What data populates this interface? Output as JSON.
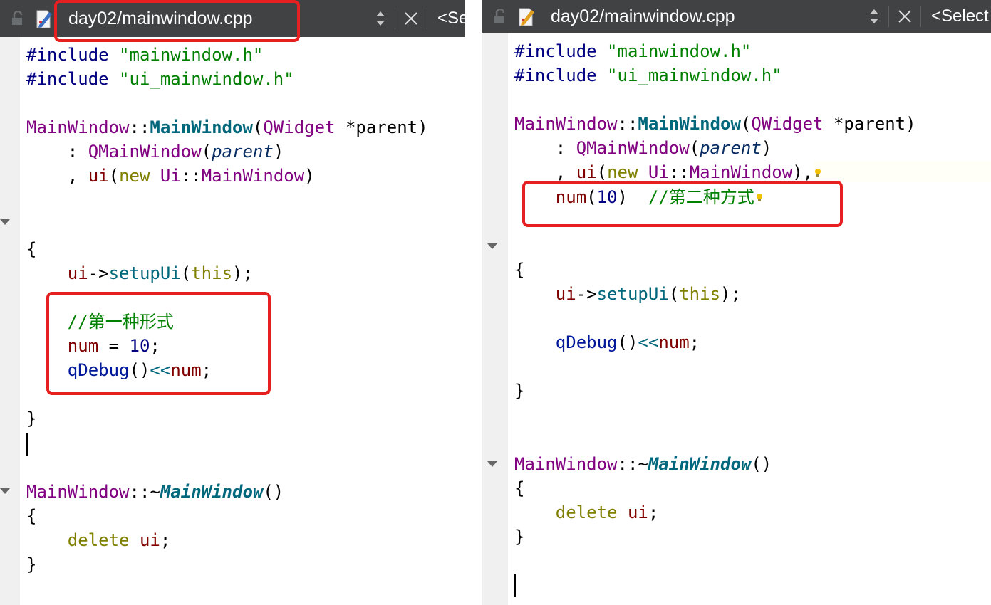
{
  "left_editor": {
    "tab": {
      "filename": "day02/mainwindow.cpp",
      "selector_label": "<Se",
      "icons": [
        "lock-icon",
        "file-edit-icon",
        "up-down-arrows-icon",
        "close-icon"
      ]
    },
    "code_lines": [
      {
        "tokens": [
          {
            "t": "#include ",
            "c": "pp"
          },
          {
            "t": "\"mainwindow.h\"",
            "c": "str"
          }
        ]
      },
      {
        "tokens": [
          {
            "t": "#include ",
            "c": "pp"
          },
          {
            "t": "\"ui_mainwindow.h\"",
            "c": "str"
          }
        ]
      },
      {
        "tokens": []
      },
      {
        "tokens": [
          {
            "t": "MainWindow",
            "c": "cls"
          },
          {
            "t": "::",
            "c": ""
          },
          {
            "t": "MainWindow",
            "c": "fnb"
          },
          {
            "t": "(",
            "c": ""
          },
          {
            "t": "QWidget",
            "c": "cls"
          },
          {
            "t": " *parent)",
            "c": ""
          }
        ]
      },
      {
        "tokens": [
          {
            "t": "    : ",
            "c": ""
          },
          {
            "t": "QMainWindow",
            "c": "cls"
          },
          {
            "t": "(",
            "c": ""
          },
          {
            "t": "parent",
            "c": "prm"
          },
          {
            "t": ")",
            "c": ""
          }
        ]
      },
      {
        "tokens": [
          {
            "t": "    , ",
            "c": ""
          },
          {
            "t": "ui",
            "c": "mem"
          },
          {
            "t": "(",
            "c": ""
          },
          {
            "t": "new",
            "c": "kw"
          },
          {
            "t": " ",
            "c": ""
          },
          {
            "t": "Ui",
            "c": "cls"
          },
          {
            "t": "::",
            "c": ""
          },
          {
            "t": "MainWindow",
            "c": "cls"
          },
          {
            "t": ")",
            "c": ""
          }
        ]
      },
      {
        "tokens": []
      },
      {
        "tokens": []
      },
      {
        "tokens": [
          {
            "t": "{",
            "c": ""
          }
        ]
      },
      {
        "tokens": [
          {
            "t": "    ",
            "c": ""
          },
          {
            "t": "ui",
            "c": "mem"
          },
          {
            "t": "->",
            "c": ""
          },
          {
            "t": "setupUi",
            "c": "fn"
          },
          {
            "t": "(",
            "c": ""
          },
          {
            "t": "this",
            "c": "kw"
          },
          {
            "t": ");",
            "c": ""
          }
        ]
      },
      {
        "tokens": []
      },
      {
        "tokens": [
          {
            "t": "    ",
            "c": ""
          },
          {
            "t": "//第一种形式",
            "c": "cmt"
          }
        ]
      },
      {
        "tokens": [
          {
            "t": "    ",
            "c": ""
          },
          {
            "t": "num",
            "c": "mem"
          },
          {
            "t": " = ",
            "c": ""
          },
          {
            "t": "10",
            "c": "num"
          },
          {
            "t": ";",
            "c": ""
          }
        ]
      },
      {
        "tokens": [
          {
            "t": "    ",
            "c": ""
          },
          {
            "t": "qDebug",
            "c": "gfn"
          },
          {
            "t": "()",
            "c": ""
          },
          {
            "t": "<<",
            "c": "fn"
          },
          {
            "t": "num",
            "c": "mem"
          },
          {
            "t": ";",
            "c": ""
          }
        ]
      },
      {
        "tokens": []
      },
      {
        "tokens": [
          {
            "t": "}",
            "c": ""
          }
        ]
      },
      {
        "tokens": []
      },
      {
        "tokens": []
      },
      {
        "tokens": [
          {
            "t": "MainWindow",
            "c": "cls"
          },
          {
            "t": "::~",
            "c": ""
          },
          {
            "t": "MainWindow",
            "c": "fnbi"
          },
          {
            "t": "()",
            "c": ""
          }
        ]
      },
      {
        "tokens": [
          {
            "t": "{",
            "c": ""
          }
        ]
      },
      {
        "tokens": [
          {
            "t": "    ",
            "c": ""
          },
          {
            "t": "delete",
            "c": "kw"
          },
          {
            "t": " ",
            "c": ""
          },
          {
            "t": "ui",
            "c": "mem"
          },
          {
            "t": ";",
            "c": ""
          }
        ]
      },
      {
        "tokens": [
          {
            "t": "}",
            "c": ""
          }
        ]
      }
    ]
  },
  "right_editor": {
    "tab": {
      "filename": "day02/mainwindow.cpp",
      "selector_label": "<Select",
      "icons": [
        "lock-icon",
        "file-edit-icon",
        "up-down-arrows-icon",
        "close-icon"
      ]
    },
    "code_lines": [
      {
        "tokens": [
          {
            "t": "#include ",
            "c": "pp"
          },
          {
            "t": "\"mainwindow.h\"",
            "c": "str"
          }
        ]
      },
      {
        "tokens": [
          {
            "t": "#include ",
            "c": "pp"
          },
          {
            "t": "\"ui_mainwindow.h\"",
            "c": "str"
          }
        ]
      },
      {
        "tokens": []
      },
      {
        "tokens": [
          {
            "t": "MainWindow",
            "c": "cls"
          },
          {
            "t": "::",
            "c": ""
          },
          {
            "t": "MainWindow",
            "c": "fnb"
          },
          {
            "t": "(",
            "c": ""
          },
          {
            "t": "QWidget",
            "c": "cls"
          },
          {
            "t": " *parent)",
            "c": ""
          }
        ]
      },
      {
        "tokens": [
          {
            "t": "    : ",
            "c": ""
          },
          {
            "t": "QMainWindow",
            "c": "cls"
          },
          {
            "t": "(",
            "c": ""
          },
          {
            "t": "parent",
            "c": "prm"
          },
          {
            "t": ")",
            "c": ""
          }
        ]
      },
      {
        "tokens": [
          {
            "t": "    , ",
            "c": ""
          },
          {
            "t": "ui",
            "c": "mem"
          },
          {
            "t": "(",
            "c": ""
          },
          {
            "t": "new",
            "c": "kw"
          },
          {
            "t": " ",
            "c": ""
          },
          {
            "t": "Ui",
            "c": "cls"
          },
          {
            "t": "::",
            "c": ""
          },
          {
            "t": "MainWindow",
            "c": "cls"
          },
          {
            "t": "),",
            "c": ""
          }
        ],
        "bulb": true
      },
      {
        "tokens": [
          {
            "t": "    ",
            "c": ""
          },
          {
            "t": "num",
            "c": "mem"
          },
          {
            "t": "(",
            "c": ""
          },
          {
            "t": "10",
            "c": "num"
          },
          {
            "t": ")  ",
            "c": ""
          },
          {
            "t": "//第二种方式",
            "c": "cmt"
          }
        ],
        "bulb": true
      },
      {
        "tokens": []
      },
      {
        "tokens": []
      },
      {
        "tokens": [
          {
            "t": "{",
            "c": ""
          }
        ]
      },
      {
        "tokens": [
          {
            "t": "    ",
            "c": ""
          },
          {
            "t": "ui",
            "c": "mem"
          },
          {
            "t": "->",
            "c": ""
          },
          {
            "t": "setupUi",
            "c": "fn"
          },
          {
            "t": "(",
            "c": ""
          },
          {
            "t": "this",
            "c": "kw"
          },
          {
            "t": ");",
            "c": ""
          }
        ]
      },
      {
        "tokens": []
      },
      {
        "tokens": [
          {
            "t": "    ",
            "c": ""
          },
          {
            "t": "qDebug",
            "c": "gfn"
          },
          {
            "t": "()",
            "c": ""
          },
          {
            "t": "<<",
            "c": "fn"
          },
          {
            "t": "num",
            "c": "mem"
          },
          {
            "t": ";",
            "c": ""
          }
        ]
      },
      {
        "tokens": []
      },
      {
        "tokens": [
          {
            "t": "}",
            "c": ""
          }
        ]
      },
      {
        "tokens": []
      },
      {
        "tokens": []
      },
      {
        "tokens": [
          {
            "t": "MainWindow",
            "c": "cls"
          },
          {
            "t": "::~",
            "c": ""
          },
          {
            "t": "MainWindow",
            "c": "fnbi"
          },
          {
            "t": "()",
            "c": ""
          }
        ]
      },
      {
        "tokens": [
          {
            "t": "{",
            "c": ""
          }
        ]
      },
      {
        "tokens": [
          {
            "t": "    ",
            "c": ""
          },
          {
            "t": "delete",
            "c": "kw"
          },
          {
            "t": " ",
            "c": ""
          },
          {
            "t": "ui",
            "c": "mem"
          },
          {
            "t": ";",
            "c": ""
          }
        ]
      },
      {
        "tokens": [
          {
            "t": "}",
            "c": ""
          }
        ]
      }
    ]
  },
  "colors": {
    "tab_background": "#404244",
    "highlight_border": "#e62020",
    "keyword": "#808000",
    "string": "#008000",
    "class": "#800080",
    "function": "#00677c",
    "member": "#800000",
    "number": "#000080"
  }
}
